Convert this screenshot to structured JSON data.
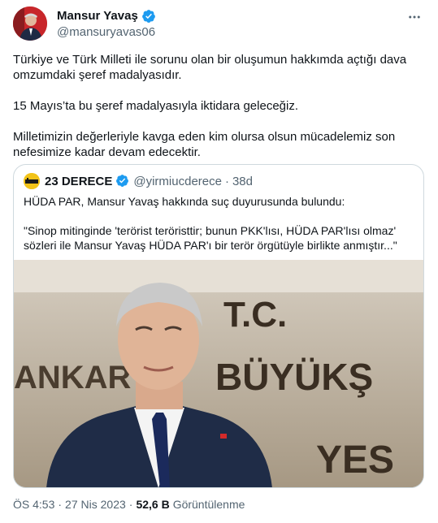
{
  "author": {
    "name": "Mansur Yavaş",
    "handle": "@mansuryavas06",
    "verified": true
  },
  "menu_icon": "more-horizontal-icon",
  "tweet": {
    "paragraphs": [
      "Türkiye ve Türk Milleti ile sorunu olan bir oluşumun hakkımda açtığı dava omzumdaki şeref madalyasıdır.",
      "15 Mayıs’ta bu şeref madalyasıyla iktidara geleceğiz.",
      "Milletimizin değerleriyle kavga eden kim olursa olsun mücadelemiz son nefesimize kadar devam edecektir."
    ]
  },
  "quoted": {
    "name": "23 DERECE",
    "handle": "@yirmiucderece",
    "separator": "·",
    "age": "38d",
    "paragraphs": [
      "HÜDA PAR, Mansur Yavaş hakkında suç duyurusunda bulundu:",
      "\"Sinop mitinginde 'terörist teröristtir; bunun PKK'lısı, HÜDA PAR'lısı olmaz' sözleri ile Mansur Yavaş HÜDA PAR'ı bir terör örgütüyle birlikte anmıştır...\""
    ],
    "image_sign": {
      "line1": "T.C.",
      "line2_left": "ANKAR",
      "line2_right": "BÜYÜKŞ",
      "line3": "YES"
    }
  },
  "footer": {
    "time": "ÖS 4:53",
    "separator": "·",
    "date": "27 Nis 2023",
    "separator2": "·",
    "views_count": "52,6 B",
    "views_label": "Görüntülenme"
  },
  "colors": {
    "verified": "#1d9bf0",
    "secondary_text": "#536471",
    "border": "#cfd9de"
  }
}
